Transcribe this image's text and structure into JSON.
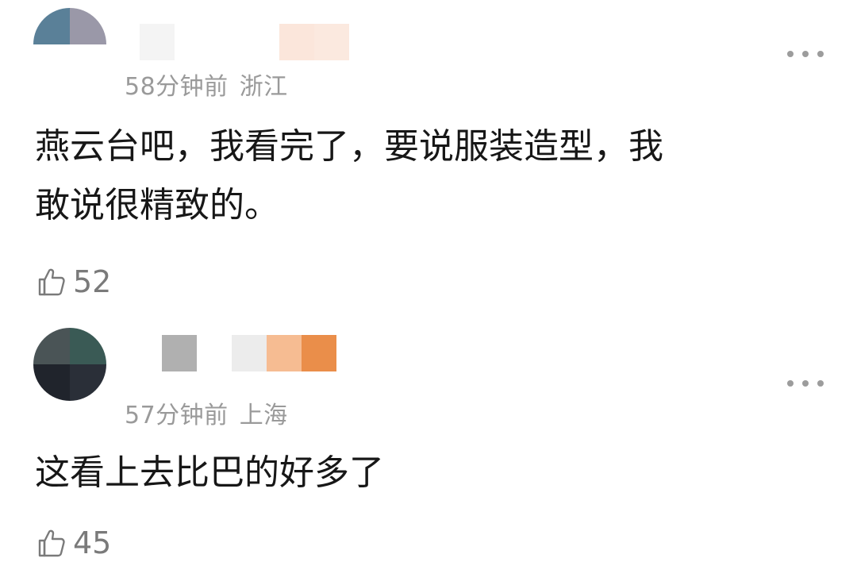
{
  "comments": [
    {
      "time": "58分钟前",
      "location": "浙江",
      "text_line1": "燕云台吧，我看完了，要说服装造型，我",
      "text_line2": "敢说很精致的。",
      "likes": "52",
      "avatar_colors": [
        "#5a8098",
        "#9a98a8",
        "#ffffff",
        "#ffffff"
      ],
      "name_mosaic_colors": [
        "#f4f4f4",
        "#ffffff",
        "#ffffff",
        "#ffffff",
        "#fbe6db",
        "#fbe9df"
      ]
    },
    {
      "time": "57分钟前",
      "location": "上海",
      "text_line1": "这看上去比巴的好多了",
      "likes": "45",
      "avatar_colors": [
        "#4a5456",
        "#3a5a55",
        "#20242c",
        "#2a2f38"
      ],
      "name_mosaic_colors": [
        "#ffffff",
        "#b0b0b0",
        "#ffffff",
        "#ececec",
        "#f6bc92",
        "#ea8e4a"
      ]
    }
  ],
  "icons": {
    "like": "thumbs-up-icon",
    "more": "more-dots-icon"
  }
}
